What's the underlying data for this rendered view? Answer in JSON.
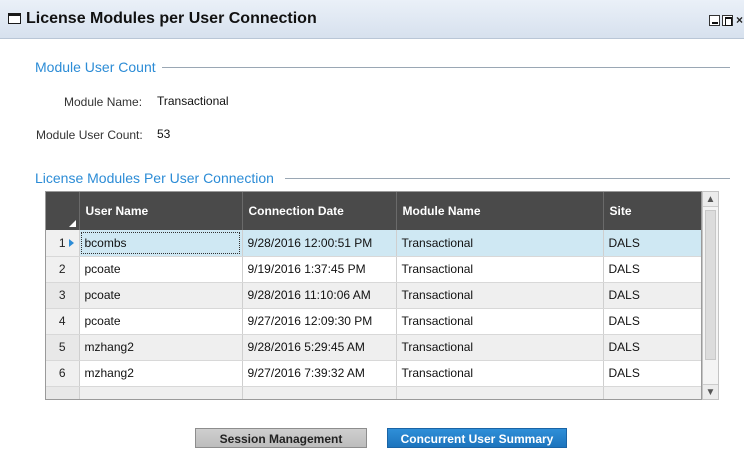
{
  "window": {
    "title": "License Modules per User Connection",
    "close_glyph": "×"
  },
  "module_section": {
    "heading": "Module User Count",
    "module_name_label": "Module Name:",
    "module_name_value": "Transactional",
    "user_count_label": "Module User Count:",
    "user_count_value": "53"
  },
  "grid_section": {
    "heading": "License Modules Per User Connection",
    "columns": [
      "User Name",
      "Connection Date",
      "Module Name",
      "Site"
    ],
    "rows": [
      {
        "num": "1",
        "user": "bcombs",
        "date": "9/28/2016 12:00:51 PM",
        "module": "Transactional",
        "site": "DALS"
      },
      {
        "num": "2",
        "user": "pcoate",
        "date": "9/19/2016 1:37:45 PM",
        "module": "Transactional",
        "site": "DALS"
      },
      {
        "num": "3",
        "user": "pcoate",
        "date": "9/28/2016 11:10:06 AM",
        "module": "Transactional",
        "site": "DALS"
      },
      {
        "num": "4",
        "user": "pcoate",
        "date": "9/27/2016 12:09:30 PM",
        "module": "Transactional",
        "site": "DALS"
      },
      {
        "num": "5",
        "user": "mzhang2",
        "date": "9/28/2016 5:29:45 AM",
        "module": "Transactional",
        "site": "DALS"
      },
      {
        "num": "6",
        "user": "mzhang2",
        "date": "9/27/2016 7:39:32 AM",
        "module": "Transactional",
        "site": "DALS"
      }
    ],
    "selected_row": "1"
  },
  "buttons": {
    "session_management": "Session Management",
    "concurrent_user_summary": "Concurrent User Summary"
  },
  "colors": {
    "accent": "#2c8cd6",
    "header_bg": "#4a4a4a",
    "selected_row": "#cfe8f3"
  }
}
